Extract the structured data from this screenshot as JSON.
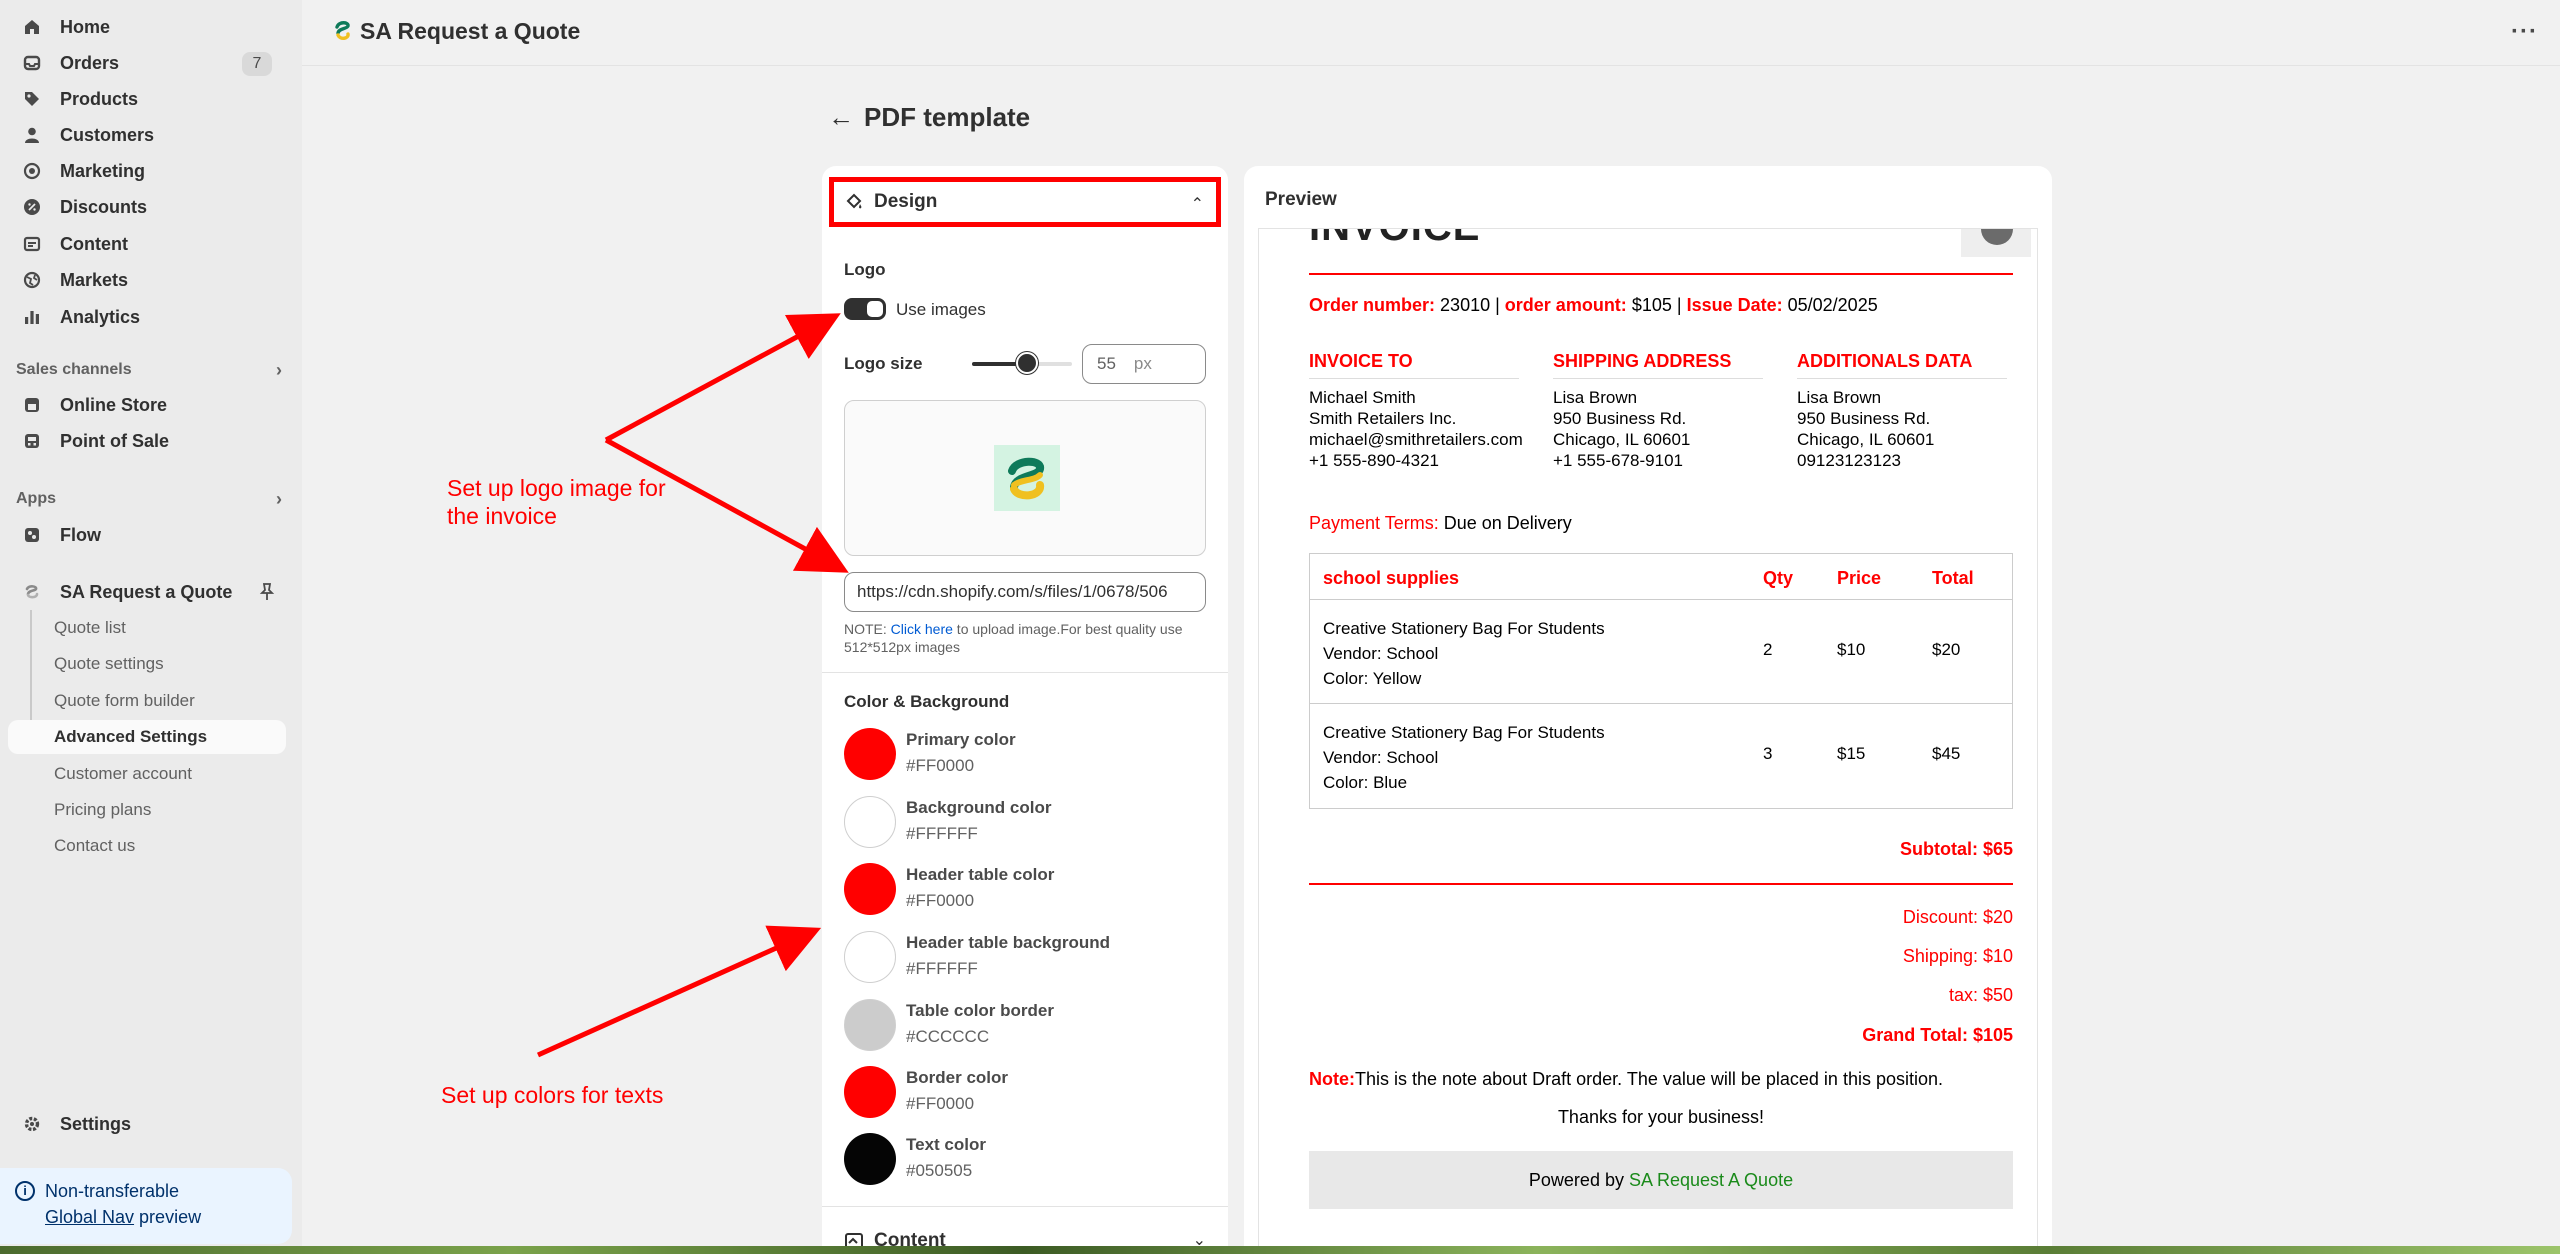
{
  "sidebar": {
    "nav": [
      {
        "label": "Home",
        "icon": "home-icon"
      },
      {
        "label": "Orders",
        "icon": "inbox-icon",
        "badge": "7"
      },
      {
        "label": "Products",
        "icon": "tag-icon"
      },
      {
        "label": "Customers",
        "icon": "person-icon"
      },
      {
        "label": "Marketing",
        "icon": "target-icon"
      },
      {
        "label": "Discounts",
        "icon": "discount-icon"
      },
      {
        "label": "Content",
        "icon": "content-icon"
      },
      {
        "label": "Markets",
        "icon": "globe-icon"
      },
      {
        "label": "Analytics",
        "icon": "bar-chart-icon"
      }
    ],
    "sales_channels": {
      "heading": "Sales channels",
      "items": [
        {
          "label": "Online Store",
          "icon": "store-icon"
        },
        {
          "label": "Point of Sale",
          "icon": "pos-icon"
        }
      ]
    },
    "apps": {
      "heading": "Apps",
      "items": [
        {
          "label": "Flow",
          "icon": "flow-icon"
        },
        {
          "label": "SA Request a Quote",
          "icon": "app-icon"
        }
      ],
      "subitems": [
        "Quote list",
        "Quote settings",
        "Quote form builder",
        "Advanced Settings",
        "Customer account",
        "Pricing plans",
        "Contact us"
      ],
      "active": "Advanced Settings"
    },
    "settings_label": "Settings",
    "global_nav": {
      "line1": "Non-transferable",
      "line2_link": "Global Nav",
      "line2_rest": " preview"
    }
  },
  "topbar": {
    "app_title": "SA Request a Quote",
    "more": "···"
  },
  "header": {
    "back": "←",
    "title": "PDF template"
  },
  "design": {
    "section_title": "Design",
    "logo_label": "Logo",
    "use_images_label": "Use images",
    "use_images_on": true,
    "logo_size_label": "Logo size",
    "logo_size_value": "55",
    "logo_size_unit": "px",
    "logo_size_fraction": 0.55,
    "logo_url": "https://cdn.shopify.com/s/files/1/0678/506",
    "note_prefix": "NOTE: ",
    "note_link": "Click here",
    "note_rest": " to upload image.For best quality use 512*512px images",
    "colors_label": "Color & Background",
    "colors": [
      {
        "name": "Primary color",
        "hex": "#FF0000"
      },
      {
        "name": "Background color",
        "hex": "#FFFFFF"
      },
      {
        "name": "Header table color",
        "hex": "#FF0000"
      },
      {
        "name": "Header table background",
        "hex": "#FFFFFF"
      },
      {
        "name": "Table color border",
        "hex": "#CCCCCC"
      },
      {
        "name": "Border color",
        "hex": "#FF0000"
      },
      {
        "name": "Text color",
        "hex": "#050505"
      }
    ],
    "content_title": "Content"
  },
  "preview": {
    "title": "Preview",
    "invoice_heading_partial": "INVOICE",
    "order_number_label": "Order number:",
    "order_number": "23010",
    "order_amount_label": "order amount:",
    "order_amount": "$105",
    "issue_date_label": "Issue Date:",
    "issue_date": "05/02/2025",
    "invoice_to": {
      "heading": "INVOICE TO",
      "lines": [
        "Michael Smith",
        "Smith Retailers Inc.",
        "michael@smithretailers.com",
        "+1 555-890-4321"
      ]
    },
    "shipping": {
      "heading": "SHIPPING ADDRESS",
      "lines": [
        "Lisa Brown",
        "950 Business Rd.",
        "Chicago, IL 60601",
        "+1 555-678-9101"
      ]
    },
    "additional": {
      "heading": "ADDITIONALS DATA",
      "lines": [
        "Lisa Brown",
        "950 Business Rd.",
        "Chicago, IL 60601",
        "09123123123"
      ]
    },
    "payment_terms_label": "Payment Terms:",
    "payment_terms": "Due on Delivery",
    "table": {
      "headers": [
        "school supplies",
        "Qty",
        "Price",
        "Total"
      ],
      "rows": [
        {
          "lines": [
            "Creative Stationery Bag For Students",
            "Vendor: School",
            "Color: Yellow"
          ],
          "qty": "2",
          "price": "$10",
          "total": "$20"
        },
        {
          "lines": [
            "Creative Stationery Bag For Students",
            "Vendor: School",
            "Color: Blue"
          ],
          "qty": "3",
          "price": "$15",
          "total": "$45"
        }
      ]
    },
    "subtotal": "Subtotal: $65",
    "discount": "Discount: $20",
    "shipping_cost": "Shipping: $10",
    "tax": "tax: $50",
    "grand_total": "Grand Total: $105",
    "note_label": "Note:",
    "note_text": "This is the note about Draft order. The value will be placed in this position.",
    "thanks": "Thanks for your business!",
    "powered_prefix": "Powered by ",
    "powered_brand": "SA Request A Quote"
  },
  "annotations": {
    "logo": "Set up logo image for the invoice",
    "colors": "Set up colors for texts"
  }
}
